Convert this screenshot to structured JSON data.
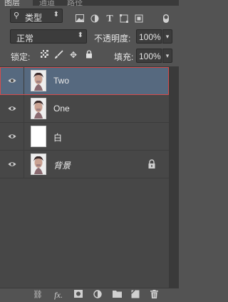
{
  "panel": {
    "tabs": [
      {
        "label": "图层",
        "active": true
      },
      {
        "label": "通道",
        "active": false
      },
      {
        "label": "路径",
        "active": false
      }
    ]
  },
  "filter": {
    "kind_label": "类型",
    "icons": [
      "image-filter-icon",
      "adjustment-filter-icon",
      "text-filter-icon",
      "shape-filter-icon",
      "smart-object-filter-icon",
      "filter-toggle-icon"
    ]
  },
  "blend": {
    "mode": "正常",
    "opacity_label": "不透明度:",
    "opacity_value": "100%"
  },
  "lock": {
    "label": "锁定:",
    "icons": [
      "lock-transparent-icon",
      "lock-pixels-icon",
      "lock-position-icon",
      "lock-all-icon"
    ],
    "fill_label": "填充:",
    "fill_value": "100%"
  },
  "layers": [
    {
      "name": "Two",
      "selected": true,
      "visible": true,
      "thumb": "portrait",
      "locked": false
    },
    {
      "name": "One",
      "selected": false,
      "visible": true,
      "thumb": "portrait",
      "locked": false
    },
    {
      "name": "白",
      "selected": false,
      "visible": true,
      "thumb": "white",
      "locked": false
    },
    {
      "name": "背景",
      "selected": false,
      "visible": true,
      "thumb": "portrait",
      "locked": true
    }
  ],
  "bottom_icons": [
    "link-layers-icon",
    "fx-icon",
    "add-mask-icon",
    "adjustment-layer-icon",
    "new-group-icon",
    "new-layer-icon",
    "delete-layer-icon"
  ],
  "colors": {
    "panel_bg": "#535353",
    "selected_row": "#56697f",
    "highlight_border": "#d44c4c"
  }
}
